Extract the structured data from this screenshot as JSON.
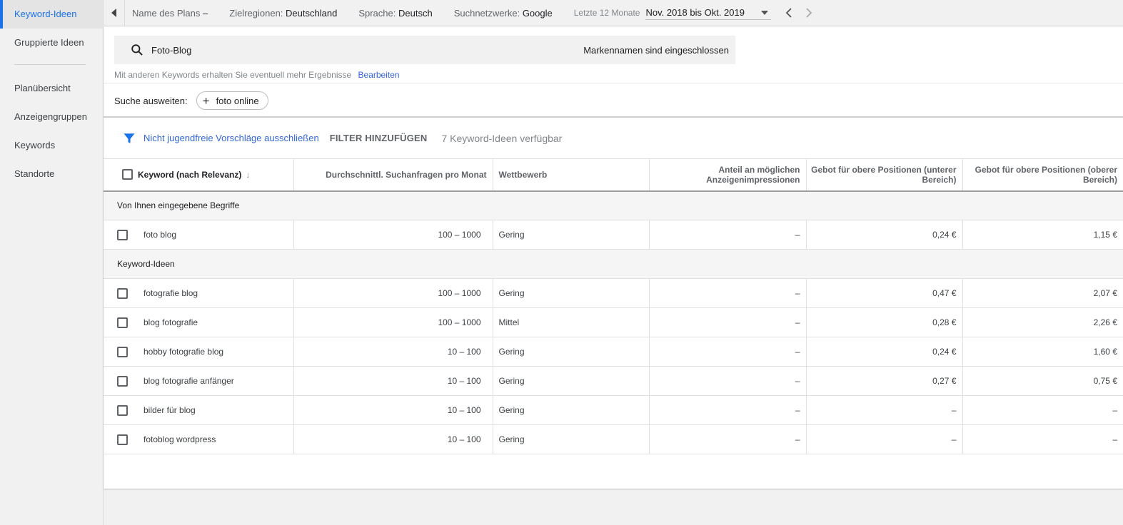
{
  "sidebar": {
    "items": [
      {
        "label": "Keyword-Ideen",
        "active": true
      },
      {
        "label": "Gruppierte Ideen",
        "active": false
      }
    ],
    "items2": [
      {
        "label": "Planübersicht"
      },
      {
        "label": "Anzeigengruppen"
      },
      {
        "label": "Keywords"
      },
      {
        "label": "Standorte"
      }
    ]
  },
  "topbar": {
    "plan_label": "Name des Plans",
    "plan_value": "–",
    "regions_label": "Zielregionen:",
    "regions_value": "Deutschland",
    "language_label": "Sprache:",
    "language_value": "Deutsch",
    "networks_label": "Suchnetzwerke:",
    "networks_value": "Google",
    "period_label": "Letzte 12 Monate",
    "period_value": "Nov. 2018 bis Okt. 2019"
  },
  "search": {
    "value": "Foto-Blog",
    "brand_note": "Markennamen sind eingeschlossen",
    "hint": "Mit anderen Keywords erhalten Sie eventuell mehr Ergebnisse",
    "edit_link": "Bearbeiten",
    "expand_label": "Suche ausweiten:",
    "expand_chip": "foto online"
  },
  "filters": {
    "exclude_adult": "Nicht jugendfreie Vorschläge ausschließen",
    "add_filter": "FILTER HINZUFÜGEN",
    "count": "7 Keyword-Ideen verfügbar"
  },
  "table": {
    "headers": {
      "keyword": "Keyword (nach Relevanz)",
      "searches": "Durchschnittl. Suchanfragen pro Monat",
      "competition": "Wettbewerb",
      "share_1": "Anteil an möglichen",
      "share_2": "Anzeigenimpressionen",
      "bid_low_1": "Gebot für obere Positionen (unterer",
      "bid_low_2": "Bereich)",
      "bid_high_1": "Gebot für obere Positionen (oberer",
      "bid_high_2": "Bereich)"
    },
    "group_entered": "Von Ihnen eingegebene Begriffe",
    "entered_rows": [
      {
        "keyword": "foto blog",
        "searches": "100 – 1000",
        "competition": "Gering",
        "share": "–",
        "bid_low": "0,24 €",
        "bid_high": "1,15 €"
      }
    ],
    "group_ideas": "Keyword-Ideen",
    "idea_rows": [
      {
        "keyword": "fotografie blog",
        "searches": "100 – 1000",
        "competition": "Gering",
        "share": "–",
        "bid_low": "0,47 €",
        "bid_high": "2,07 €"
      },
      {
        "keyword": "blog fotografie",
        "searches": "100 – 1000",
        "competition": "Mittel",
        "share": "–",
        "bid_low": "0,28 €",
        "bid_high": "2,26 €"
      },
      {
        "keyword": "hobby fotografie blog",
        "searches": "10 – 100",
        "competition": "Gering",
        "share": "–",
        "bid_low": "0,24 €",
        "bid_high": "1,60 €"
      },
      {
        "keyword": "blog fotografie anfänger",
        "searches": "10 – 100",
        "competition": "Gering",
        "share": "–",
        "bid_low": "0,27 €",
        "bid_high": "0,75 €"
      },
      {
        "keyword": "bilder für blog",
        "searches": "10 – 100",
        "competition": "Gering",
        "share": "–",
        "bid_low": "–",
        "bid_high": "–"
      },
      {
        "keyword": "fotoblog wordpress",
        "searches": "10 – 100",
        "competition": "Gering",
        "share": "–",
        "bid_low": "–",
        "bid_high": "–"
      }
    ]
  },
  "colors": {
    "accent": "#1a73e8",
    "link": "#3367d6"
  },
  "icons": {
    "search": "search-icon",
    "filter": "filter-icon",
    "back": "back-arrow-icon",
    "caret": "caret-down-icon",
    "prev": "chevron-left-icon",
    "next": "chevron-right-icon",
    "sort": "arrow-down-icon",
    "plus": "plus-icon"
  }
}
